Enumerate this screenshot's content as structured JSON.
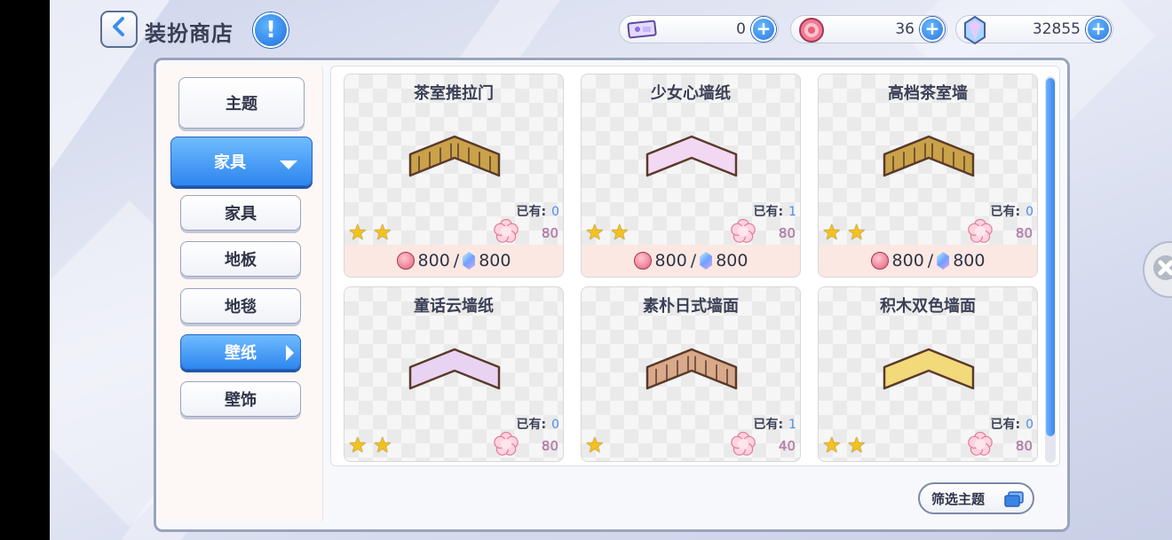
{
  "header": {
    "title": "装扮商店",
    "back_icon": "chevron-left-icon",
    "info_icon": "exclamation-icon"
  },
  "currencies": [
    {
      "icon": "ticket-icon",
      "value": "0"
    },
    {
      "icon": "coin-icon",
      "value": "36"
    },
    {
      "icon": "crystal-icon",
      "value": "32855"
    }
  ],
  "sidebar": {
    "items": [
      {
        "label": "主题",
        "state": "normal"
      },
      {
        "label": "家具",
        "state": "expanded"
      },
      {
        "label": "家具",
        "state": "normal"
      },
      {
        "label": "地板",
        "state": "normal"
      },
      {
        "label": "地毯",
        "state": "normal"
      },
      {
        "label": "壁纸",
        "state": "selected"
      },
      {
        "label": "壁饰",
        "state": "normal"
      }
    ]
  },
  "items": [
    {
      "name": "茶室推拉门",
      "owned_label": "已有:",
      "owned": "0",
      "stars": 2,
      "points": "80",
      "price_coin": "800",
      "price_gem": "800",
      "color": "#c9a24a"
    },
    {
      "name": "少女心墙纸",
      "owned_label": "已有:",
      "owned": "1",
      "stars": 2,
      "points": "80",
      "price_coin": "800",
      "price_gem": "800",
      "color": "#f3d8f3"
    },
    {
      "name": "高档茶室墙",
      "owned_label": "已有:",
      "owned": "0",
      "stars": 2,
      "points": "80",
      "price_coin": "800",
      "price_gem": "800",
      "color": "#c9a24a"
    },
    {
      "name": "童话云墙纸",
      "owned_label": "已有:",
      "owned": "0",
      "stars": 2,
      "points": "80",
      "color": "#e8d4f2"
    },
    {
      "name": "素朴日式墙面",
      "owned_label": "已有:",
      "owned": "1",
      "stars": 1,
      "points": "40",
      "color": "#d8a98a"
    },
    {
      "name": "积木双色墙面",
      "owned_label": "已有:",
      "owned": "0",
      "stars": 2,
      "points": "80",
      "color": "#f2d97a"
    }
  ],
  "filter": {
    "label": "筛选主题",
    "icon": "cards-icon"
  },
  "star_glyph": "★",
  "slash": "/"
}
